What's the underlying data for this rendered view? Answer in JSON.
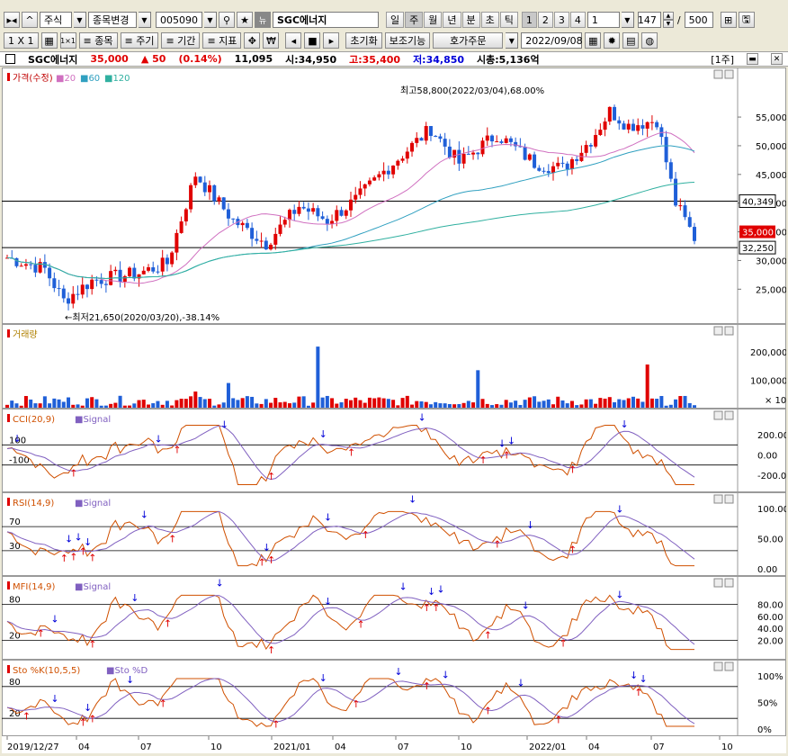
{
  "toolbar1": {
    "market": "주식",
    "change_label": "종목변경",
    "code": "005090",
    "new_badge": "뉴",
    "name": "SGC에너지",
    "periods": [
      "일",
      "주",
      "월",
      "년",
      "분",
      "초",
      "틱"
    ],
    "active_period": "주",
    "nums": [
      "1",
      "2",
      "3",
      "4"
    ],
    "active_num": "1",
    "interval_value": "1",
    "count": "147",
    "slash": "/",
    "max": "500"
  },
  "toolbar2": {
    "ratio": "1 X 1",
    "symbol_btn": "≡ 종목",
    "cycle_btn": "≡ 주기",
    "period_btn": "≡ 기간",
    "indicator_btn": "≡ 지표",
    "won_btn": "₩",
    "reset_btn": "초기화",
    "aux_btn": "보조기능",
    "order_btn": "호가주문",
    "date": "2022/09/08"
  },
  "infobar": {
    "name": "SGC에너지",
    "price": "35,000",
    "change": "▲ 50",
    "change_pct": "(0.14%)",
    "volume": "11,095",
    "open": "시:34,950",
    "high": "고:35,400",
    "low": "저:34,850",
    "mcap": "시총:5,136억",
    "period_badge": "[1주]"
  },
  "panels": {
    "price": {
      "title": "가격(수정)",
      "ma": [
        "20",
        "60",
        "120"
      ],
      "yticks": [
        "55,000",
        "50,000",
        "45,000",
        "40,000",
        "35,000",
        "30,000",
        "25,000"
      ],
      "ticks": [
        55000,
        50000,
        45000,
        40000,
        35000,
        30000,
        25000
      ],
      "hline_high": "40,349",
      "hline_low": "32,250",
      "last": "35,000",
      "high_note": "최고58,800(2022/03/04),68.00%",
      "low_note": "←최저21,650(2020/03/20),-38.14%"
    },
    "volume": {
      "title": "거래량",
      "yticks": [
        "200,000",
        "100,000"
      ],
      "scale": "× 10"
    },
    "cci": {
      "title": "CCI(20,9)",
      "signal": "Signal",
      "yticks": [
        "200.00",
        "0.00",
        "-200.00"
      ],
      "levels": [
        "100",
        "-100"
      ]
    },
    "rsi": {
      "title": "RSI(14,9)",
      "signal": "Signal",
      "yticks": [
        "100.00",
        "50.00",
        "0.00"
      ],
      "levels": [
        "70",
        "30"
      ]
    },
    "mfi": {
      "title": "MFI(14,9)",
      "signal": "Signal",
      "yticks": [
        "80.00",
        "60.00",
        "40.00",
        "20.00"
      ],
      "levels": [
        "80",
        "20"
      ]
    },
    "sto": {
      "title": "Sto %K(10,5,5)",
      "signal": "Sto %D",
      "yticks": [
        "100%",
        "50%",
        "0%"
      ],
      "levels": [
        "80",
        "20"
      ]
    }
  },
  "xaxis": [
    "2019/12/27",
    "04",
    "07",
    "10",
    "2021/01",
    "04",
    "07",
    "10",
    "2022/01",
    "04",
    "07",
    "10"
  ],
  "colors": {
    "up": "#e00000",
    "down": "#1f5fd8",
    "ma20": "#d070c0",
    "ma60": "#30a0c0",
    "ma120": "#30b0a0"
  }
}
